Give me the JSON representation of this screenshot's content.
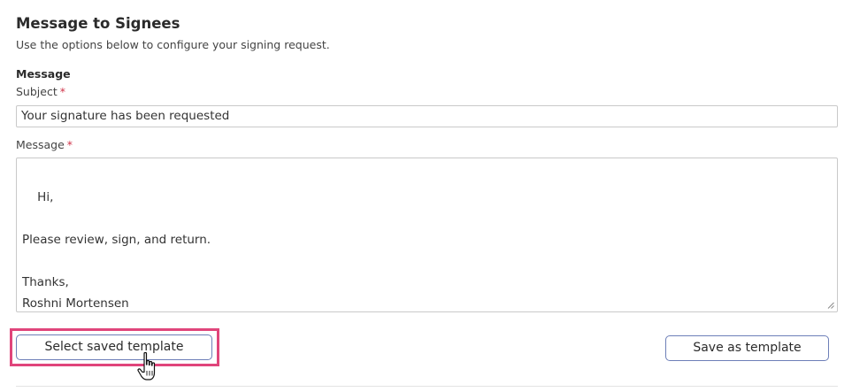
{
  "section": {
    "title": "Message to Signees",
    "subtitle": "Use the options below to configure your signing request.",
    "group_label": "Message"
  },
  "subject": {
    "label": "Subject",
    "required_marker": "*",
    "value": "Your signature has been requested"
  },
  "message": {
    "label": "Message",
    "required_marker": "*",
    "value": "Hi,\n\nPlease review, sign, and return.\n\nThanks,\nRoshni Mortensen"
  },
  "buttons": {
    "select_template": "Select saved template",
    "save_template": "Save as template"
  },
  "colors": {
    "highlight": "#e0457b",
    "required": "#d0344a",
    "button_border": "#6d7fb8"
  },
  "icons": {
    "cursor": "hand-pointer-icon",
    "resize": "resize-grip-icon"
  }
}
